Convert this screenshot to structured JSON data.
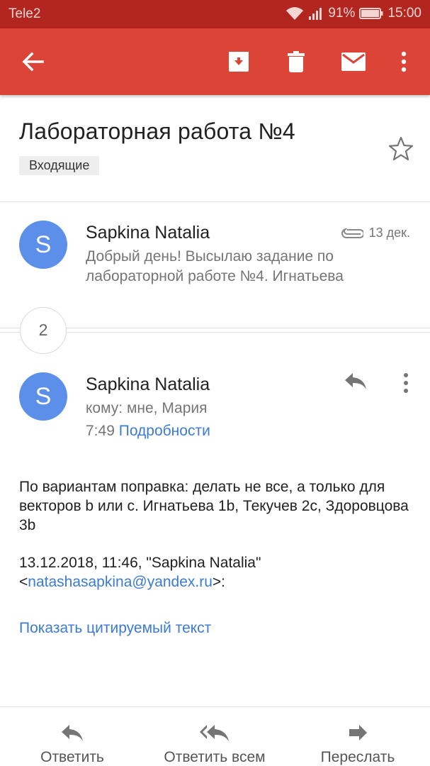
{
  "status_bar": {
    "carrier": "Tele2",
    "battery": "91%",
    "time": "15:00"
  },
  "app_bar": {
    "icons": [
      "back-arrow-icon",
      "archive-icon",
      "delete-icon",
      "mark-unread-icon",
      "more-vert-icon"
    ]
  },
  "thread": {
    "subject": "Лабораторная работа №4",
    "label": "Входящие",
    "collapsed_count": "2"
  },
  "collapsed_message": {
    "avatar_letter": "S",
    "sender": "Sapkina Natalia",
    "date": "13 дек.",
    "snippet": "Добрый день! Высылаю задание по лабораторной работе №4. Игнатьева"
  },
  "message": {
    "avatar_letter": "S",
    "sender": "Sapkina Natalia",
    "to": "кому: мне, Мария",
    "time": "7:49",
    "details_link": "Подробности",
    "body": "По вариантам поправка: делать не все, а только для векторов b или с. Игнатьева 1b, Текучев 2с, Здоровцова 3b",
    "quote_header": "13.12.2018, 11:46, \"Sapkina Natalia\"",
    "quote_email": "natashasapkina@yandex.ru",
    "quote_open": "<",
    "quote_close": ">:",
    "show_quoted": "Показать цитируемый текст"
  },
  "bottom_actions": {
    "reply": "Ответить",
    "reply_all": "Ответить всем",
    "forward": "Переслать"
  },
  "colors": {
    "app_bar": "#db4437",
    "status_bar": "#b3261f",
    "avatar": "#5b8fea",
    "link": "#3b7bd4"
  }
}
